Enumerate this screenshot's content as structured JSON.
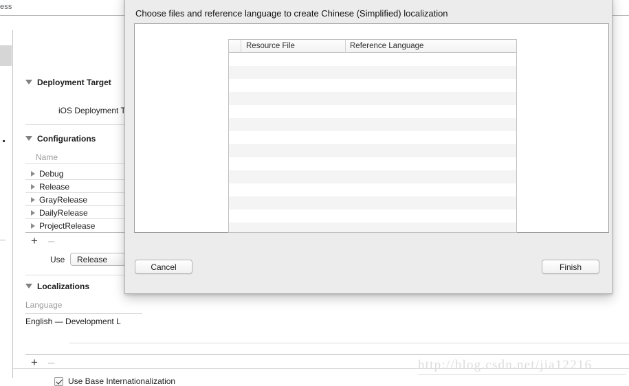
{
  "window": {
    "breadcrumb_fragment": "ess"
  },
  "editor": {
    "deployment_target": {
      "header": "Deployment Target",
      "field_label": "iOS Deployment T"
    },
    "configurations": {
      "header": "Configurations",
      "column_header": "Name",
      "rows": [
        "Debug",
        "Release",
        "GrayRelease",
        "DailyRelease",
        "ProjectRelease"
      ],
      "add_label": "+",
      "remove_label": "–",
      "use_label": "Use",
      "use_value": "Release"
    },
    "localizations": {
      "header": "Localizations",
      "column_header": "Language",
      "rows": [
        "English — Development L"
      ],
      "add_label": "+",
      "remove_label": "–",
      "base_internationalization_label": "Use Base Internationalization",
      "base_internationalization_checked": true
    }
  },
  "sheet": {
    "title": "Choose files and reference language to create Chinese (Simplified) localization",
    "table": {
      "columns": [
        "",
        "Resource File",
        "Reference Language"
      ],
      "rows": [],
      "empty_row_count": 14
    },
    "cancel_label": "Cancel",
    "finish_label": "Finish"
  },
  "watermark": {
    "text": "http://blog.csdn.net/jia12216"
  }
}
